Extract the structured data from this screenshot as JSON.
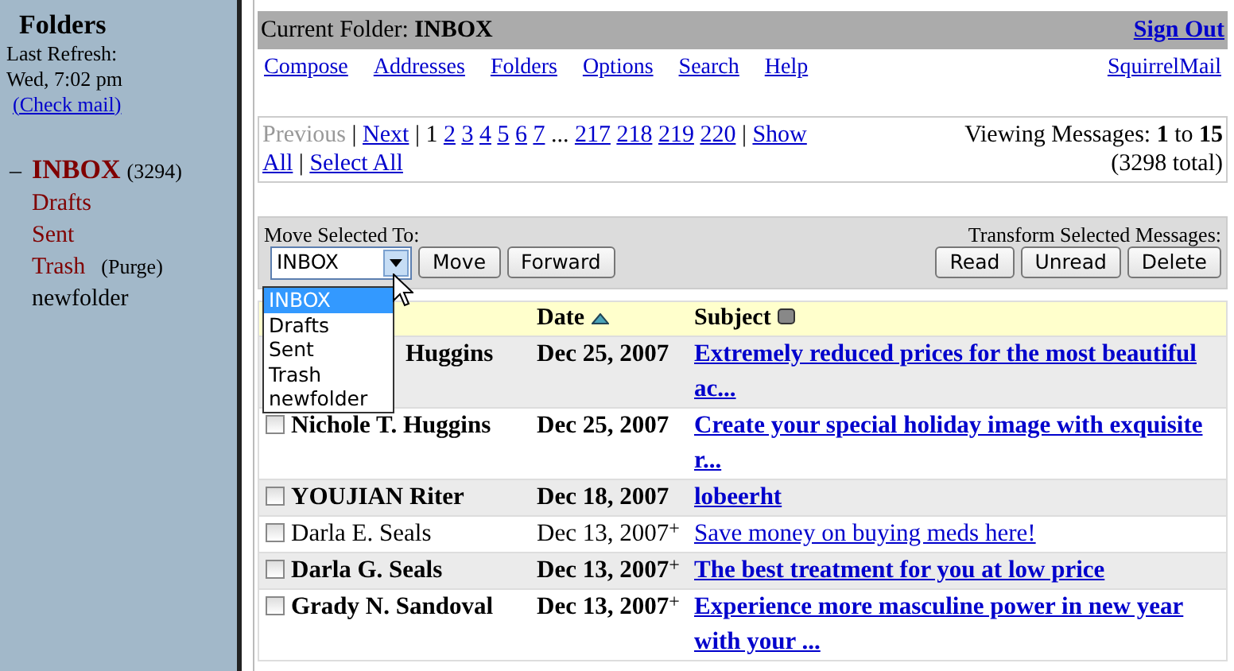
{
  "sidebar": {
    "title": "Folders",
    "refresh_label": "Last Refresh:",
    "refresh_time": "Wed, 7:02 pm",
    "check_mail": "(Check mail)",
    "folders": [
      {
        "name": "INBOX",
        "marker": "–",
        "count": "(3294)",
        "selected": true,
        "kind": "special"
      },
      {
        "name": "Drafts",
        "selected": false,
        "kind": "special"
      },
      {
        "name": "Sent",
        "selected": false,
        "kind": "special"
      },
      {
        "name": "Trash",
        "action": "(Purge)",
        "selected": false,
        "kind": "special"
      },
      {
        "name": "newfolder",
        "selected": false,
        "kind": "custom"
      }
    ]
  },
  "header": {
    "label": "Current Folder:",
    "folder": "INBOX",
    "sign_out": "Sign Out"
  },
  "menu": [
    "Compose",
    "Addresses",
    "Folders",
    "Options",
    "Search",
    "Help"
  ],
  "brand": "SquirrelMail",
  "pagination": {
    "items": [
      {
        "text": "Previous",
        "kind": "disabled"
      },
      {
        "text": "|",
        "kind": "sep"
      },
      {
        "text": "Next",
        "kind": "link"
      },
      {
        "text": "|",
        "kind": "sep"
      },
      {
        "text": "1",
        "kind": "current"
      },
      {
        "text": "2",
        "kind": "link"
      },
      {
        "text": "3",
        "kind": "link"
      },
      {
        "text": "4",
        "kind": "link"
      },
      {
        "text": "5",
        "kind": "link"
      },
      {
        "text": "6",
        "kind": "link"
      },
      {
        "text": "7",
        "kind": "link"
      },
      {
        "text": "...",
        "kind": "sep"
      },
      {
        "text": "217",
        "kind": "link"
      },
      {
        "text": "218",
        "kind": "link"
      },
      {
        "text": "219",
        "kind": "link"
      },
      {
        "text": "220",
        "kind": "link"
      },
      {
        "text": "|",
        "kind": "sep"
      },
      {
        "text": "Show",
        "kind": "link"
      },
      {
        "text": "All",
        "kind": "link"
      },
      {
        "text": "|",
        "kind": "sep"
      },
      {
        "text": "Select All",
        "kind": "link"
      }
    ],
    "viewing": "Viewing Messages: **1** to **15**",
    "total": "(3298 total)"
  },
  "toolbar": {
    "move_label": "Move Selected To:",
    "select_value": "INBOX",
    "options": [
      {
        "label": "INBOX",
        "selected": true
      },
      {
        "label": "Drafts",
        "selected": false
      },
      {
        "label": "Sent",
        "selected": false
      },
      {
        "label": "Trash",
        "selected": false
      },
      {
        "label": "newfolder",
        "selected": false
      }
    ],
    "move_buttons": [
      "Move",
      "Forward"
    ],
    "transform_label": "Transform Selected Messages:",
    "transform_buttons": [
      "Read",
      "Unread",
      "Delete"
    ]
  },
  "columns": [
    {
      "label": "Date",
      "sorted": true
    },
    {
      "label": "Subject",
      "sorted": false
    }
  ],
  "rows": [
    {
      "sender": "Huggins",
      "date": "Dec 25, 2007",
      "subject": "Extremely reduced prices for the most beautiful ac...",
      "unread": true
    },
    {
      "sender": "Nichole T. Huggins",
      "date": "Dec 25, 2007",
      "subject": "Create your special holiday image with exquisite r...",
      "unread": true,
      "checked": false
    },
    {
      "sender": "YOUJIAN Riter",
      "date": "Dec 18, 2007",
      "subject": "lobeerht",
      "unread": true,
      "checked": false
    },
    {
      "sender": "Darla E. Seals",
      "date": "Dec 13, 2007",
      "flag": "+",
      "subject": "Save money on buying meds here!",
      "unread": false,
      "checked": false
    },
    {
      "sender": "Darla G. Seals",
      "date": "Dec 13, 2007",
      "flag": "+",
      "subject": "The best treatment for you at low price",
      "unread": true,
      "checked": false
    },
    {
      "sender": "Grady N. Sandoval",
      "date": "Dec 13, 2007",
      "flag": "+",
      "subject": "Experience more masculine power in new year with your ...",
      "unread": true,
      "checked": false
    }
  ]
}
